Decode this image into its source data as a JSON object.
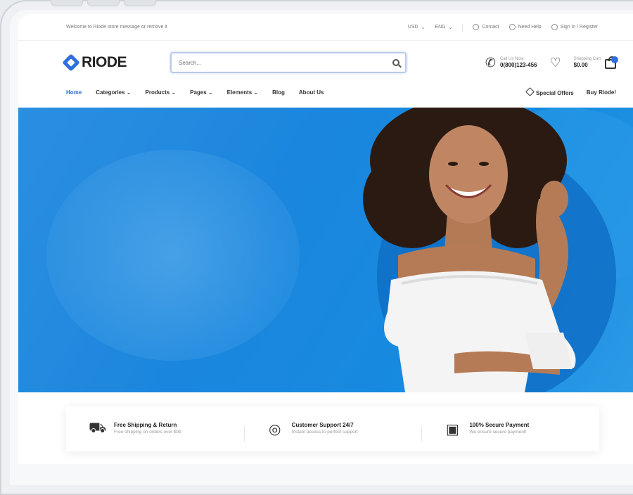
{
  "topbar": {
    "welcome": "Welcome to Riode store message or remove it",
    "currency": "USD",
    "language": "ENG",
    "contact": "Contact",
    "help": "Need Help",
    "signin": "Sign in / Register"
  },
  "header": {
    "logo": "RIODE",
    "search_placeholder": "Search...",
    "call_label": "Call Us Now:",
    "call_number": "0(800)123-456",
    "cart_label": "Shopping Cart",
    "cart_total": "$0.00"
  },
  "nav": {
    "items": [
      "Home",
      "Categories ⌄",
      "Products ⌄",
      "Pages ⌄",
      "Elements ⌄",
      "Blog",
      "About Us"
    ],
    "special_offers": "Special Offers",
    "buy": "Buy Riode!"
  },
  "features": [
    {
      "title": "Free Shipping & Return",
      "subtitle": "Free shipping on orders over $99",
      "icon": "truck-icon"
    },
    {
      "title": "Customer Support 24/7",
      "subtitle": "Instant access to perfect support",
      "icon": "support-icon"
    },
    {
      "title": "100% Secure Payment",
      "subtitle": "We ensure secure payment!",
      "icon": "payment-icon"
    }
  ],
  "colors": {
    "accent": "#2f6fe0",
    "hero_blue": "#1b86de"
  }
}
